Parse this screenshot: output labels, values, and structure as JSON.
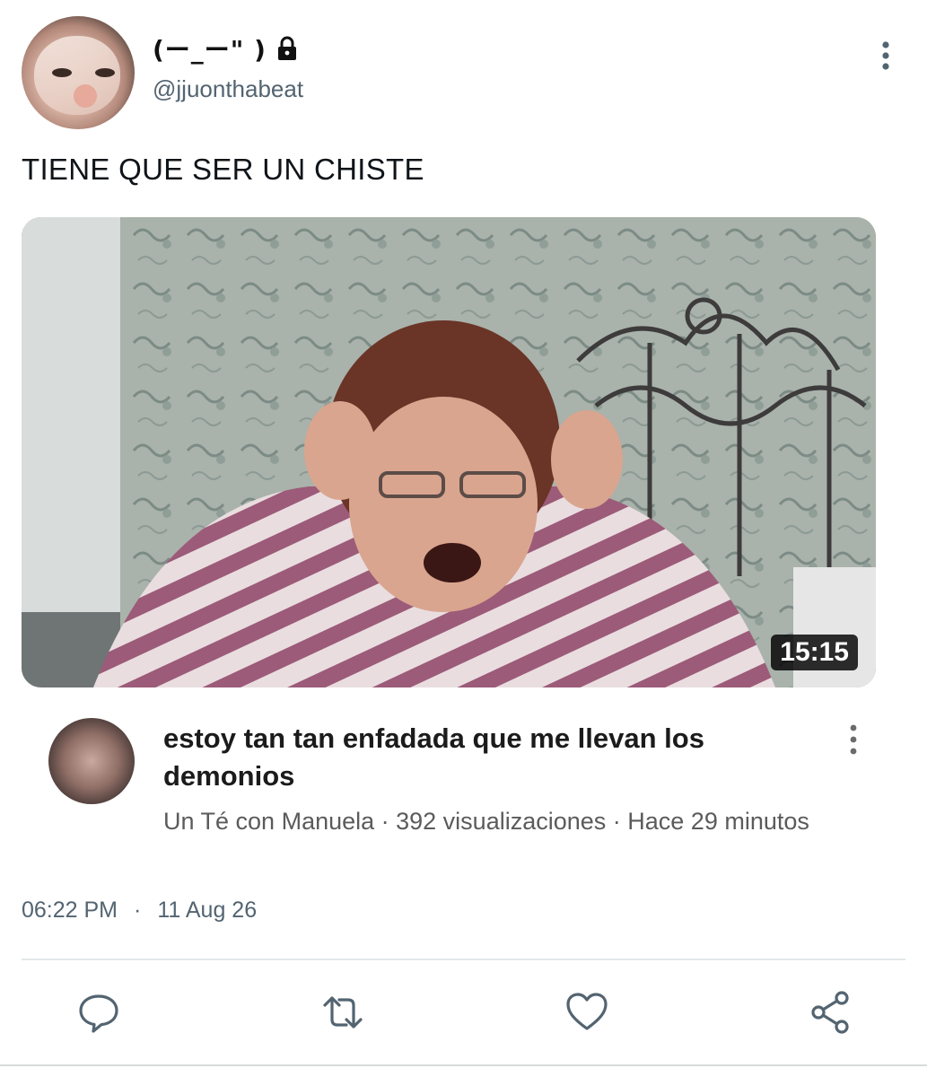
{
  "tweet": {
    "user_name": "(ー_ー\" )",
    "handle": "@jjuonthabeat",
    "text": "TIENE QUE SER UN CHISTE",
    "time": "06:22 PM",
    "date": "11 Aug 26"
  },
  "video": {
    "duration": "15:15",
    "title": "estoy tan tan enfadada que me llevan los demonios",
    "meta": "Un Té con Manuela · 392 visualizaciones · Hace 29 minutos"
  },
  "icons": {
    "lock": "lock-icon",
    "more": "more-vertical-icon",
    "reply": "reply-icon",
    "retweet": "retweet-icon",
    "like": "heart-icon",
    "share": "share-icon"
  },
  "colors": {
    "text_primary": "#0f1419",
    "text_secondary": "#536471",
    "icon_gray": "#536471"
  }
}
